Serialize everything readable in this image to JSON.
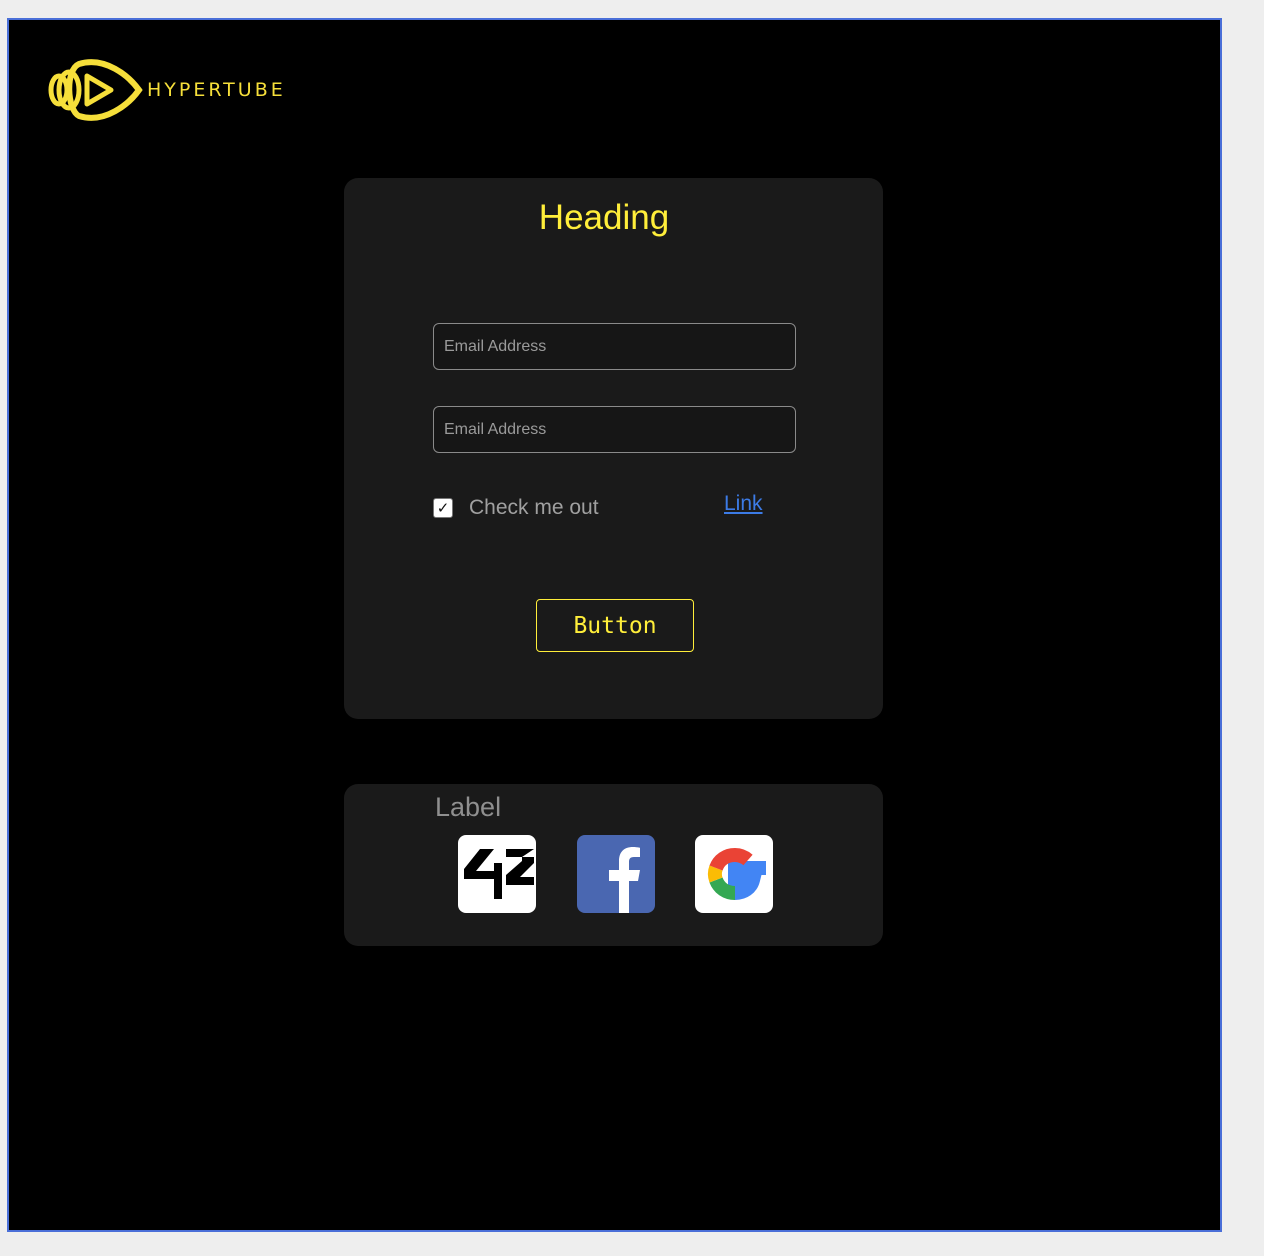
{
  "brand": {
    "name": "HYPERTUBE",
    "color": "#f6df3a"
  },
  "form": {
    "heading": "Heading",
    "fields": [
      {
        "placeholder": "Email Address",
        "value": ""
      },
      {
        "placeholder": "Email Address",
        "value": ""
      }
    ],
    "checkbox": {
      "label": "Check me out",
      "checked": true
    },
    "link_label": "Link",
    "button_label": "Button"
  },
  "oauth": {
    "label": "Label",
    "providers": [
      {
        "name": "42",
        "icon": "42-logo-icon"
      },
      {
        "name": "Facebook",
        "icon": "facebook-icon"
      },
      {
        "name": "Google",
        "icon": "google-icon"
      }
    ]
  },
  "colors": {
    "accent": "#ffee3a",
    "link": "#3c7be6",
    "frame_border": "#4a6fd8",
    "card_bg": "#1a1a1a"
  }
}
